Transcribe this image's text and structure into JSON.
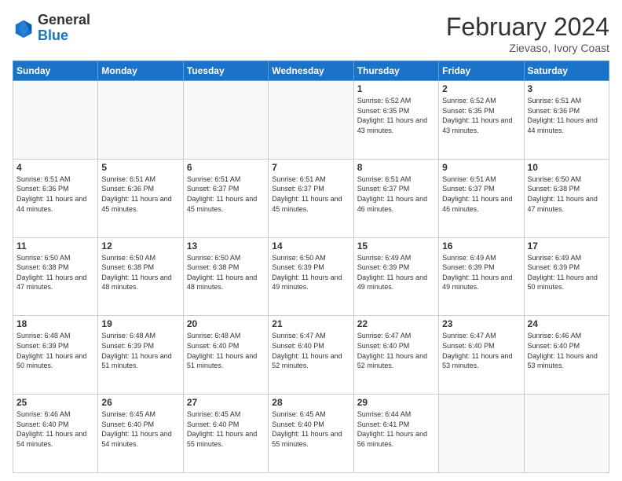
{
  "logo": {
    "general": "General",
    "blue": "Blue"
  },
  "header": {
    "month": "February 2024",
    "location": "Zievaso, Ivory Coast"
  },
  "days_of_week": [
    "Sunday",
    "Monday",
    "Tuesday",
    "Wednesday",
    "Thursday",
    "Friday",
    "Saturday"
  ],
  "weeks": [
    [
      {
        "day": "",
        "info": ""
      },
      {
        "day": "",
        "info": ""
      },
      {
        "day": "",
        "info": ""
      },
      {
        "day": "",
        "info": ""
      },
      {
        "day": "1",
        "info": "Sunrise: 6:52 AM\nSunset: 6:35 PM\nDaylight: 11 hours and 43 minutes."
      },
      {
        "day": "2",
        "info": "Sunrise: 6:52 AM\nSunset: 6:35 PM\nDaylight: 11 hours and 43 minutes."
      },
      {
        "day": "3",
        "info": "Sunrise: 6:51 AM\nSunset: 6:36 PM\nDaylight: 11 hours and 44 minutes."
      }
    ],
    [
      {
        "day": "4",
        "info": "Sunrise: 6:51 AM\nSunset: 6:36 PM\nDaylight: 11 hours and 44 minutes."
      },
      {
        "day": "5",
        "info": "Sunrise: 6:51 AM\nSunset: 6:36 PM\nDaylight: 11 hours and 45 minutes."
      },
      {
        "day": "6",
        "info": "Sunrise: 6:51 AM\nSunset: 6:37 PM\nDaylight: 11 hours and 45 minutes."
      },
      {
        "day": "7",
        "info": "Sunrise: 6:51 AM\nSunset: 6:37 PM\nDaylight: 11 hours and 45 minutes."
      },
      {
        "day": "8",
        "info": "Sunrise: 6:51 AM\nSunset: 6:37 PM\nDaylight: 11 hours and 46 minutes."
      },
      {
        "day": "9",
        "info": "Sunrise: 6:51 AM\nSunset: 6:37 PM\nDaylight: 11 hours and 46 minutes."
      },
      {
        "day": "10",
        "info": "Sunrise: 6:50 AM\nSunset: 6:38 PM\nDaylight: 11 hours and 47 minutes."
      }
    ],
    [
      {
        "day": "11",
        "info": "Sunrise: 6:50 AM\nSunset: 6:38 PM\nDaylight: 11 hours and 47 minutes."
      },
      {
        "day": "12",
        "info": "Sunrise: 6:50 AM\nSunset: 6:38 PM\nDaylight: 11 hours and 48 minutes."
      },
      {
        "day": "13",
        "info": "Sunrise: 6:50 AM\nSunset: 6:38 PM\nDaylight: 11 hours and 48 minutes."
      },
      {
        "day": "14",
        "info": "Sunrise: 6:50 AM\nSunset: 6:39 PM\nDaylight: 11 hours and 49 minutes."
      },
      {
        "day": "15",
        "info": "Sunrise: 6:49 AM\nSunset: 6:39 PM\nDaylight: 11 hours and 49 minutes."
      },
      {
        "day": "16",
        "info": "Sunrise: 6:49 AM\nSunset: 6:39 PM\nDaylight: 11 hours and 49 minutes."
      },
      {
        "day": "17",
        "info": "Sunrise: 6:49 AM\nSunset: 6:39 PM\nDaylight: 11 hours and 50 minutes."
      }
    ],
    [
      {
        "day": "18",
        "info": "Sunrise: 6:48 AM\nSunset: 6:39 PM\nDaylight: 11 hours and 50 minutes."
      },
      {
        "day": "19",
        "info": "Sunrise: 6:48 AM\nSunset: 6:39 PM\nDaylight: 11 hours and 51 minutes."
      },
      {
        "day": "20",
        "info": "Sunrise: 6:48 AM\nSunset: 6:40 PM\nDaylight: 11 hours and 51 minutes."
      },
      {
        "day": "21",
        "info": "Sunrise: 6:47 AM\nSunset: 6:40 PM\nDaylight: 11 hours and 52 minutes."
      },
      {
        "day": "22",
        "info": "Sunrise: 6:47 AM\nSunset: 6:40 PM\nDaylight: 11 hours and 52 minutes."
      },
      {
        "day": "23",
        "info": "Sunrise: 6:47 AM\nSunset: 6:40 PM\nDaylight: 11 hours and 53 minutes."
      },
      {
        "day": "24",
        "info": "Sunrise: 6:46 AM\nSunset: 6:40 PM\nDaylight: 11 hours and 53 minutes."
      }
    ],
    [
      {
        "day": "25",
        "info": "Sunrise: 6:46 AM\nSunset: 6:40 PM\nDaylight: 11 hours and 54 minutes."
      },
      {
        "day": "26",
        "info": "Sunrise: 6:45 AM\nSunset: 6:40 PM\nDaylight: 11 hours and 54 minutes."
      },
      {
        "day": "27",
        "info": "Sunrise: 6:45 AM\nSunset: 6:40 PM\nDaylight: 11 hours and 55 minutes."
      },
      {
        "day": "28",
        "info": "Sunrise: 6:45 AM\nSunset: 6:40 PM\nDaylight: 11 hours and 55 minutes."
      },
      {
        "day": "29",
        "info": "Sunrise: 6:44 AM\nSunset: 6:41 PM\nDaylight: 11 hours and 56 minutes."
      },
      {
        "day": "",
        "info": ""
      },
      {
        "day": "",
        "info": ""
      }
    ]
  ]
}
